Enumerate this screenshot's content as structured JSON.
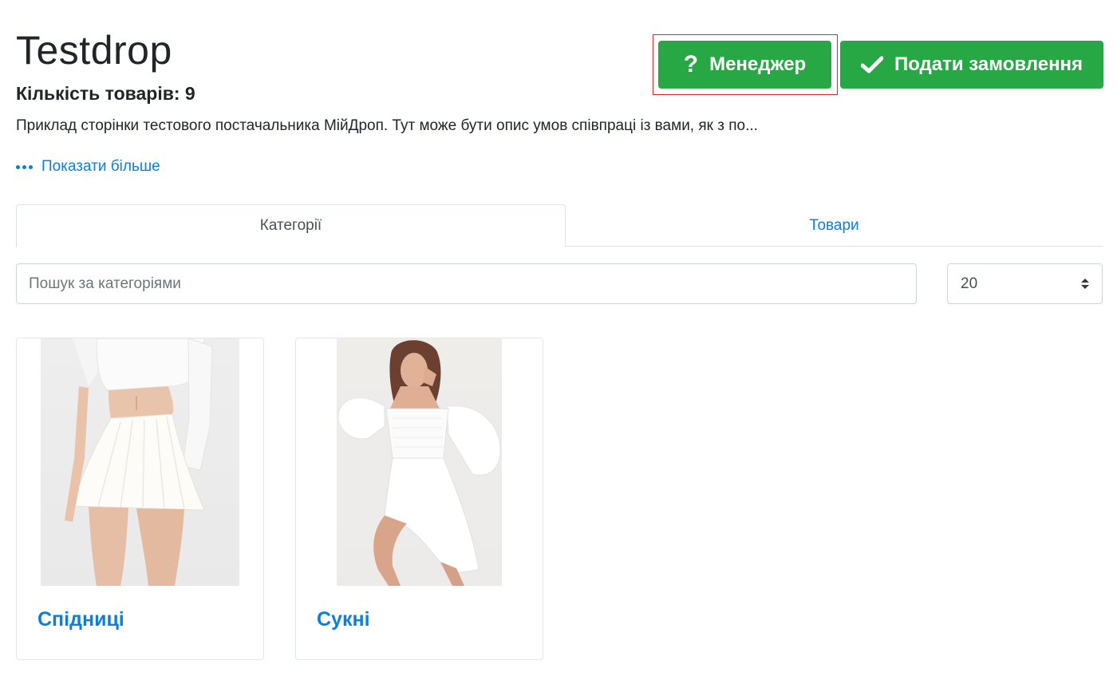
{
  "header": {
    "title": "Testdrop",
    "product_count": "Кількість товарів: 9",
    "description": "Приклад сторінки тестового постачальника МійДроп. Тут може бути опис умов співпраці із вами, як з по...",
    "show_more": "Показати більше"
  },
  "actions": {
    "manager_label": "Менеджер",
    "order_label": "Подати замовлення"
  },
  "tabs": [
    {
      "label": "Категорії",
      "active": true
    },
    {
      "label": "Товари",
      "active": false
    }
  ],
  "filters": {
    "search_placeholder": "Пошук за категоріями",
    "search_value": "",
    "per_page": "20"
  },
  "categories": [
    {
      "name": "Спідниці",
      "image": "white-pleated-skirt-photo"
    },
    {
      "name": "Сукні",
      "image": "white-dress-photo"
    }
  ],
  "colors": {
    "primary_green": "#28a745",
    "link_blue": "#0d7fd8",
    "highlight_red": "#e0242c"
  }
}
